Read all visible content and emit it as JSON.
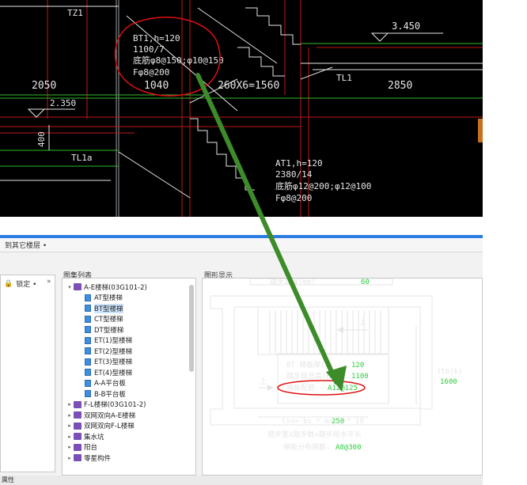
{
  "cad": {
    "labels": {
      "tz1": "TZ1",
      "elev_3450": "3.450",
      "bt_h": "BT1,h=120",
      "bt_steps": "1100/7",
      "bt_rebar": "底筋φ8@150;φ10@150",
      "bt_dist": "Fφ8@200",
      "tl1": "TL1",
      "dim_2050": "2050",
      "dim_1040": "1040",
      "dim_260x6": "260X6=1560",
      "dim_2850": "2850",
      "elev_2350": "2.350",
      "dim_400": "400",
      "tl1a": "TL1a",
      "at_h": "AT1,h=120",
      "at_steps": "2380/14",
      "at_rebar": "底筋φ12@200;φ12@100",
      "at_dist": "Fφ8@200"
    }
  },
  "app": {
    "toolbar_text": "到其它楼层 •",
    "left_pane": {
      "lock_label": "锁定 •",
      "expand": "»"
    },
    "tree_title": "图集列表",
    "preview_title": "图形显示",
    "tree": [
      {
        "level": 0,
        "kind": "book",
        "label": "A-E楼梯(03G101-2)",
        "expanded": true
      },
      {
        "level": 1,
        "kind": "doc",
        "label": "AT型楼梯"
      },
      {
        "level": 1,
        "kind": "doc",
        "label": "BT型楼梯",
        "selected": true
      },
      {
        "level": 1,
        "kind": "doc",
        "label": "CT型楼梯"
      },
      {
        "level": 1,
        "kind": "doc",
        "label": "DT型楼梯"
      },
      {
        "level": 1,
        "kind": "doc",
        "label": "ET(1)型楼梯"
      },
      {
        "level": 1,
        "kind": "doc",
        "label": "ET(2)型楼梯"
      },
      {
        "level": 1,
        "kind": "doc",
        "label": "ET(3)型楼梯"
      },
      {
        "level": 1,
        "kind": "doc",
        "label": "ET(4)型楼梯"
      },
      {
        "level": 1,
        "kind": "doc",
        "label": "A-A平台板"
      },
      {
        "level": 1,
        "kind": "doc",
        "label": "B-B平台板"
      },
      {
        "level": 0,
        "kind": "book",
        "label": "F-L楼梯(03G101-2)"
      },
      {
        "level": 0,
        "kind": "book",
        "label": "双网双向A-E楼梯"
      },
      {
        "level": 0,
        "kind": "book",
        "label": "双网双向F-L楼梯"
      },
      {
        "level": 0,
        "kind": "book",
        "label": "集水坑"
      },
      {
        "level": 0,
        "kind": "book",
        "label": "阳台"
      },
      {
        "level": 0,
        "kind": "book",
        "label": "零星构件"
      }
    ],
    "preview": {
      "header_text": "踏步高度(mm)",
      "header_value": "60",
      "up1": "上",
      "up2": "上",
      "bt_label": "BT.梯板厚(h):",
      "bt_value": "120",
      "step_total_label": "踏步段总高(Hs):",
      "step_total_value": "1100",
      "rebar_label": "梯板配筋:",
      "rebar_value": "A12@125",
      "tbjk_label": "(tbjk)",
      "tbjk_value": "1600",
      "lsn_label": "lsn= bs * m=",
      "lsn_value": "250",
      "lsn_mult": "* 10",
      "width_label": "踏步宽X踏步数=踏步段水平长",
      "dist_label": "梯板分布钢筋:",
      "dist_value": "A8@300"
    },
    "status_text": "属性"
  },
  "colors": {
    "cad_bg": "#000000",
    "highlight_red": "#e01010",
    "arrow_green": "#3c8c2a",
    "accent_blue": "#2b7de1",
    "value_green": "#2ecc40"
  }
}
